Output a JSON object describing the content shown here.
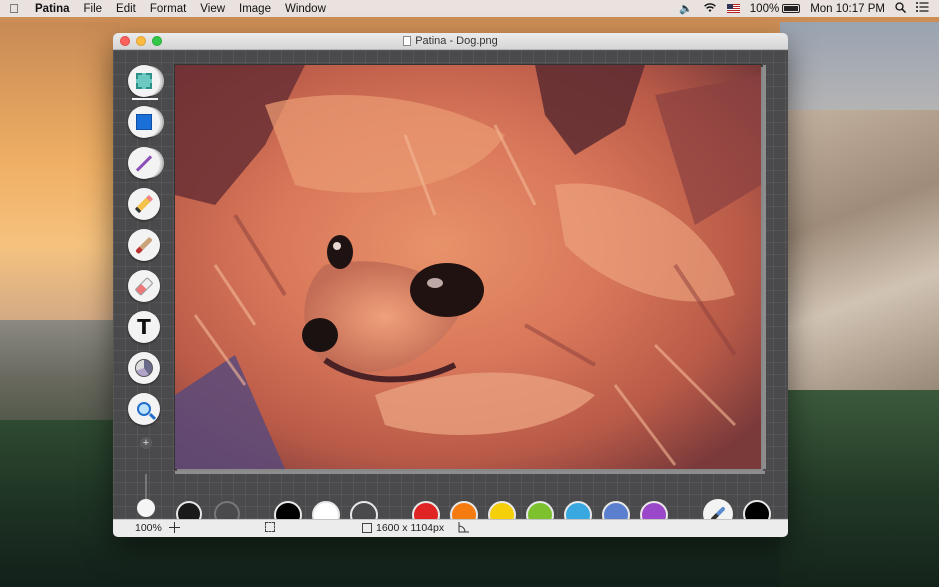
{
  "menubar": {
    "app_name": "Patina",
    "items": [
      "File",
      "Edit",
      "Format",
      "View",
      "Image",
      "Window"
    ],
    "battery": "100%",
    "clock": "Mon 10:17 PM"
  },
  "window": {
    "title": "Patina - Dog.png"
  },
  "tools": [
    {
      "name": "select-tool",
      "icon": "selection-icon",
      "active": true
    },
    {
      "name": "rectangle-tool",
      "icon": "rectangle-icon"
    },
    {
      "name": "line-tool",
      "icon": "line-icon"
    },
    {
      "name": "pencil-tool",
      "icon": "pencil-icon"
    },
    {
      "name": "brush-tool",
      "icon": "brush-icon"
    },
    {
      "name": "eraser-tool",
      "icon": "eraser-icon"
    },
    {
      "name": "text-tool",
      "icon": "text-icon",
      "glyph": "T"
    },
    {
      "name": "fill-tool",
      "icon": "fill-icon"
    },
    {
      "name": "zoom-tool",
      "icon": "magnifier-icon"
    }
  ],
  "brush_size": {
    "plus": "+",
    "minus": "−"
  },
  "palette": {
    "stroke_colors": [
      "#1a1a1a",
      "#4a4a4c"
    ],
    "colors": [
      "#000000",
      "#ffffff",
      "#4a4a4c",
      "#e02424",
      "#f57a10",
      "#f5cf0a",
      "#7dc22e",
      "#3aa8e0",
      "#5a7fcf",
      "#9b47c9"
    ],
    "current_color": "#000000"
  },
  "statusbar": {
    "zoom": "100%",
    "dimensions": "1600 x 1104px"
  }
}
